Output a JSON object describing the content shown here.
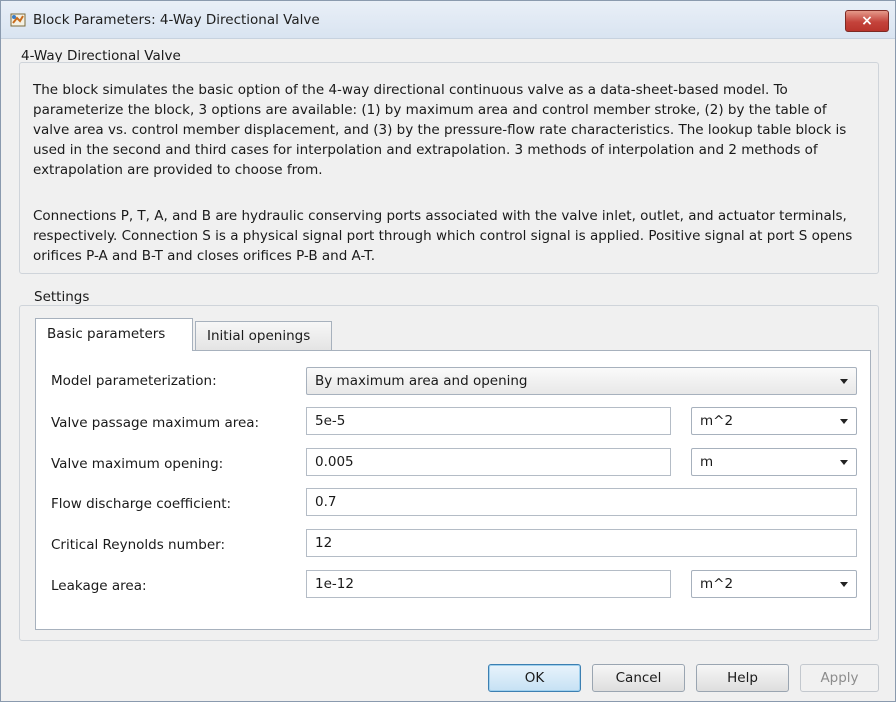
{
  "window": {
    "title": "Block Parameters: 4-Way Directional Valve",
    "close_glyph": "×"
  },
  "block": {
    "name": "4-Way Directional Valve",
    "description_p1": "The block simulates the basic option of the 4-way directional continuous valve as a data-sheet-based model. To parameterize the block, 3 options are available: (1) by maximum area and control member stroke, (2) by the table of valve area vs. control member displacement, and (3) by the pressure-flow rate characteristics. The lookup table block is used in the second and third cases for interpolation and extrapolation. 3 methods of interpolation and 2 methods of extrapolation are provided to choose from.",
    "description_p2": "Connections P, T, A, and B are hydraulic conserving ports associated with the valve inlet, outlet, and actuator terminals, respectively. Connection S is a physical signal port through which control signal is applied. Positive signal at port S opens orifices P-A and B-T and closes orifices P-B and A-T."
  },
  "settings": {
    "label": "Settings",
    "tabs": [
      {
        "label": "Basic parameters",
        "selected": true
      },
      {
        "label": "Initial openings",
        "selected": false
      }
    ],
    "params": {
      "model_param": {
        "label": "Model parameterization:",
        "value": "By maximum area and opening"
      },
      "max_area": {
        "label": "Valve passage maximum area:",
        "value": "5e-5",
        "unit": "m^2"
      },
      "max_opening": {
        "label": "Valve maximum opening:",
        "value": "0.005",
        "unit": "m"
      },
      "flow_coeff": {
        "label": "Flow discharge coefficient:",
        "value": "0.7"
      },
      "reynolds": {
        "label": "Critical Reynolds number:",
        "value": "12"
      },
      "leakage": {
        "label": "Leakage area:",
        "value": "1e-12",
        "unit": "m^2"
      }
    }
  },
  "buttons": {
    "ok": "OK",
    "cancel": "Cancel",
    "help": "Help",
    "apply": "Apply"
  },
  "colors": {
    "close_button": "#c4433b",
    "default_button_border": "#3c7fb1",
    "disabled_text": "#8c8c8c"
  }
}
